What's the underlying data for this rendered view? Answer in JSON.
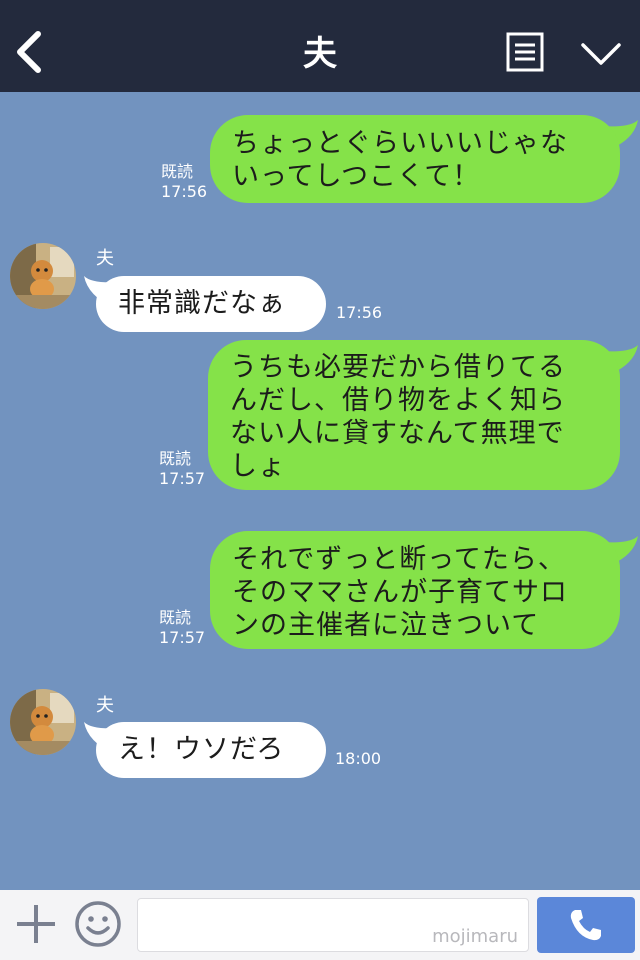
{
  "header": {
    "title": "夫",
    "back_icon": "chevron-left-icon",
    "menu_icon": "memo-icon",
    "dropdown_icon": "chevron-down-icon"
  },
  "messages": [
    {
      "side": "me",
      "text": "ちょっとぐらいいいじゃな\nいってしつこくて！",
      "read": "既読",
      "time": "17:56"
    },
    {
      "side": "other",
      "sender": "夫",
      "text": "非常識だなぁ",
      "time": "17:56"
    },
    {
      "side": "me",
      "text": "うちも必要だから借りてる\nんだし、借り物をよく知ら\nない人に貸すなんて無理で\nしょ",
      "read": "既読",
      "time": "17:57"
    },
    {
      "side": "me",
      "text": "それでずっと断ってたら、\nそのママさんが子育てサロ\nンの主催者に泣きついて",
      "read": "既読",
      "time": "17:57"
    },
    {
      "side": "other",
      "sender": "夫",
      "text": "え！ウソだろ",
      "time": "18:00"
    }
  ],
  "footer": {
    "input_value": "",
    "watermark": "mojimaru",
    "add_icon": "plus-icon",
    "sticker_icon": "smile-icon",
    "call_icon": "phone-icon"
  },
  "colors": {
    "header_bg": "#232a3d",
    "chat_bg": "#7293bf",
    "my_bubble": "#85e249",
    "their_bubble": "#ffffff",
    "call_button": "#5b87d9"
  }
}
